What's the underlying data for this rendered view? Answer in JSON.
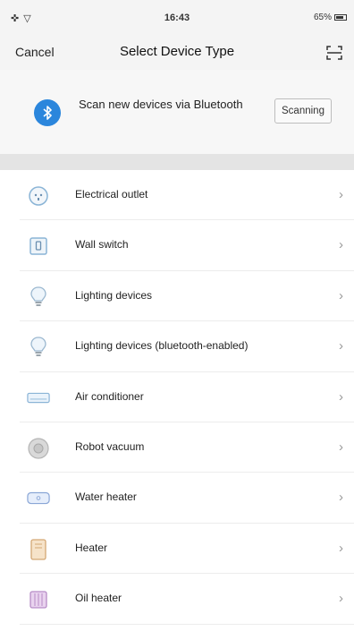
{
  "status_bar": {
    "left": "✜ ▽",
    "time": "16:43",
    "battery_text": "65%"
  },
  "nav": {
    "cancel_label": "Cancel",
    "title": "Select Device Type",
    "scan_icon": "qr-scan-icon"
  },
  "bluetooth_card": {
    "icon": "bluetooth-icon",
    "text": "Scan new devices via Bluetooth",
    "button_label": "Scanning",
    "accent_color": "#2b86dc"
  },
  "devices": [
    {
      "label": "Electrical outlet",
      "icon": "electrical-outlet-icon"
    },
    {
      "label": "Wall switch",
      "icon": "wall-switch-icon"
    },
    {
      "label": "Lighting devices",
      "icon": "light-bulb-icon"
    },
    {
      "label": "Lighting devices (bluetooth-enabled)",
      "icon": "light-bulb-icon"
    },
    {
      "label": "Air conditioner",
      "icon": "air-conditioner-icon"
    },
    {
      "label": "Robot vacuum",
      "icon": "robot-vacuum-icon"
    },
    {
      "label": "Water heater",
      "icon": "water-heater-icon"
    },
    {
      "label": "Heater",
      "icon": "heater-icon"
    },
    {
      "label": "Oil heater",
      "icon": "oil-heater-icon"
    }
  ],
  "chevron": "›"
}
